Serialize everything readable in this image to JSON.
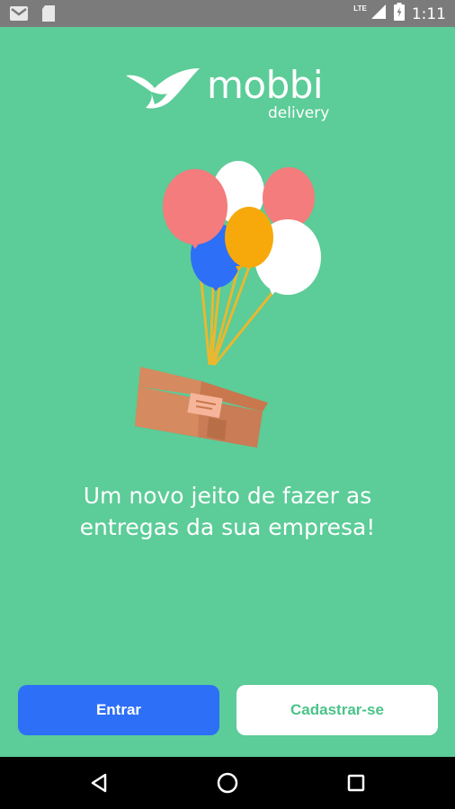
{
  "status_bar": {
    "time": "1:11",
    "network": "LTE",
    "icons": [
      "gmail-icon",
      "sim-card-icon",
      "signal-icon",
      "battery-icon"
    ]
  },
  "brand": {
    "name": "mobbi",
    "subtitle": "delivery"
  },
  "tagline": {
    "line1": "Um novo jeito de fazer as",
    "line2": "entregas da sua empresa!"
  },
  "buttons": {
    "login": "Entrar",
    "signup": "Cadastrar-se"
  },
  "nav_bar": {
    "icons": [
      "back-icon",
      "home-icon",
      "recents-icon"
    ]
  },
  "colors": {
    "background": "#5ccc98",
    "primary_button": "#2d6ff7",
    "secondary_button_text": "#4ac38a"
  }
}
